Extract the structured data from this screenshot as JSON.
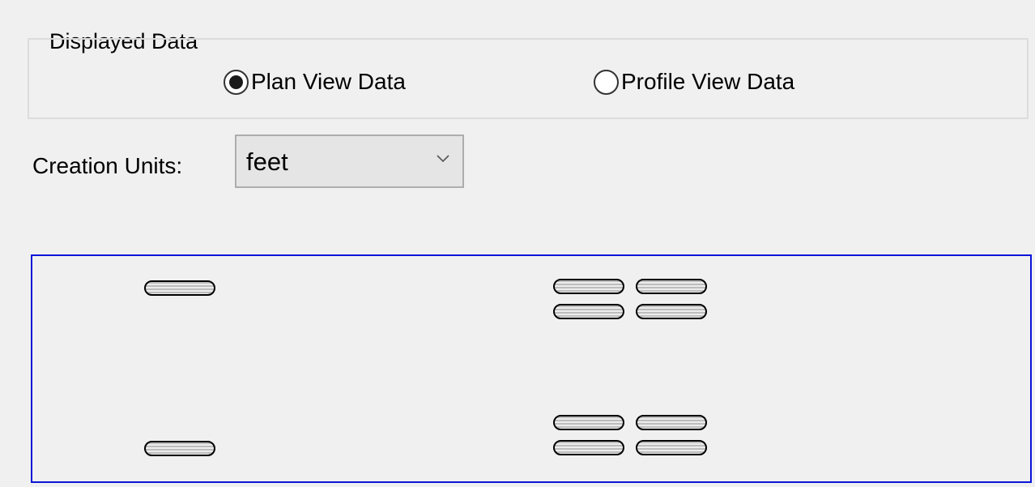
{
  "displayed_data": {
    "title": "Displayed Data",
    "options": [
      {
        "label": "Plan View Data",
        "selected": true
      },
      {
        "label": "Profile View Data",
        "selected": false
      }
    ]
  },
  "creation_units": {
    "label": "Creation Units:",
    "value": "feet",
    "chevron_icon": "chevron-down-icon"
  },
  "preview": {
    "border_color": "#0a14d8",
    "label_marker_count": 10
  }
}
